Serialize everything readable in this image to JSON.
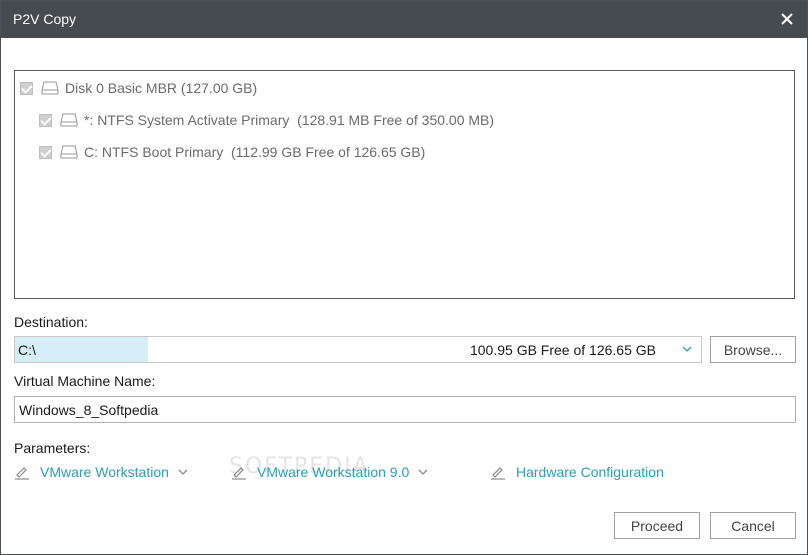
{
  "window": {
    "title": "P2V Copy"
  },
  "disk_tree": {
    "root": {
      "label": "Disk 0 Basic MBR (127.00 GB)",
      "checked": true
    },
    "partitions": [
      {
        "label": "*: NTFS System Activate Primary  (128.91 MB Free of 350.00 MB)",
        "checked": true
      },
      {
        "label": "C: NTFS Boot Primary  (112.99 GB Free of 126.65 GB)",
        "checked": true
      }
    ]
  },
  "destination": {
    "label": "Destination:",
    "value": "C:\\",
    "free_space": "100.95 GB Free of 126.65 GB",
    "browse_label": "Browse..."
  },
  "vm_name": {
    "label": "Virtual Machine Name:",
    "value": "Windows_8_Softpedia"
  },
  "parameters": {
    "label": "Parameters:",
    "items": [
      {
        "label": "VMware Workstation",
        "has_dropdown": true
      },
      {
        "label": "VMware Workstation 9.0",
        "has_dropdown": true
      },
      {
        "label": "Hardware Configuration",
        "has_dropdown": false
      }
    ]
  },
  "watermark": "SOFTPEDIA",
  "footer": {
    "proceed_label": "Proceed",
    "cancel_label": "Cancel"
  },
  "colors": {
    "titlebar": "#464b50",
    "link": "#2a9fb5",
    "selection": "#d6eef5"
  }
}
